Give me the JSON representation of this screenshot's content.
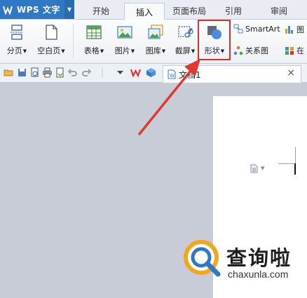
{
  "app": {
    "name": "WPS 文字"
  },
  "tabs": [
    {
      "label": "开始",
      "active": false
    },
    {
      "label": "插入",
      "active": true
    },
    {
      "label": "页面布局",
      "active": false
    },
    {
      "label": "引用",
      "active": false
    },
    {
      "label": "审阅",
      "active": false
    }
  ],
  "ribbon": {
    "page_break": "分页",
    "blank_page": "空白页",
    "table": "表格",
    "picture": "图片",
    "gallery": "图库",
    "screenshot": "截屏",
    "shape": "形状",
    "smartart": "SmartArt",
    "chart_partial": "图",
    "relation": "关系图",
    "online_partial": "在"
  },
  "document": {
    "tab_title": "文档1",
    "close_glyph": "×"
  },
  "watermark": {
    "title": "查询啦",
    "domain": "chaxunla.com"
  },
  "colors": {
    "accent": "#2f78c4",
    "highlight": "#d8312a",
    "arrow": "#e03a30"
  }
}
